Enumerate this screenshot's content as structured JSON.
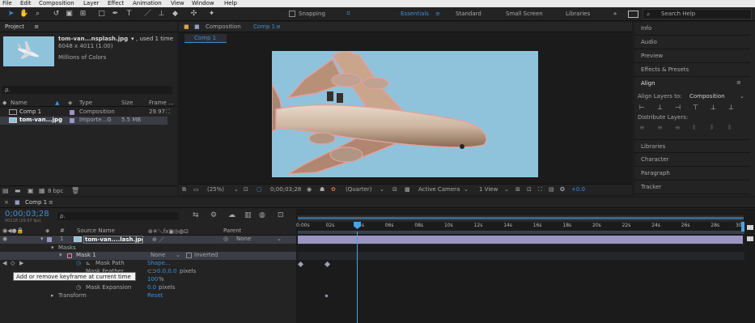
{
  "menu": [
    "File",
    "Edit",
    "Composition",
    "Layer",
    "Effect",
    "Animation",
    "View",
    "Window",
    "Help"
  ],
  "toolbar": {
    "snapping_label": "Snapping",
    "workspaces": [
      "Essentials",
      "Standard",
      "Small Screen",
      "Libraries"
    ],
    "overflow_glyph": "»",
    "search_placeholder": "Search Help"
  },
  "project": {
    "panel_title": "Project",
    "asset_name": "tom-van...nsplash.jpg",
    "asset_used": ", used 1 time",
    "asset_dims": "6048 x 4011 (1.00)",
    "asset_colors": "Millions of Colors",
    "search_icon_label": "ρ.",
    "columns": [
      "Name",
      "Type",
      "Size",
      "Frame ..."
    ],
    "items": [
      {
        "name": "Comp 1",
        "type": "Composition",
        "size": "",
        "frame": "29.97"
      },
      {
        "name": "tom-van...jpg",
        "type": "Importe...G",
        "size": "5.5 MB",
        "frame": ""
      }
    ],
    "bpc": "8 bpc"
  },
  "composition": {
    "panel_title": "Composition",
    "comp_name": "Comp 1",
    "tab_label": "Comp 1",
    "zoom": "(25%)",
    "timecode": "0;00;03;28",
    "resolution": "(Quarter)",
    "camera": "Active Camera",
    "views": "1 View",
    "exposure": "+0.0"
  },
  "right_panel": {
    "items_top": [
      "Info",
      "Audio",
      "Preview",
      "Effects & Presets"
    ],
    "align_title": "Align",
    "align_to_label": "Align Layers to:",
    "align_to_value": "Composition",
    "distribute_label": "Distribute Layers:",
    "items_bottom": [
      "Libraries",
      "Character",
      "Paragraph",
      "Tracker"
    ]
  },
  "timeline": {
    "tab": "Comp 1",
    "timecode": "0;00;03;28",
    "timecode_sub": "00118 (29.97 fps)",
    "search_icon_label": "ρ.",
    "col_source": "Source Name",
    "col_parent": "Parent",
    "layer_num": "1",
    "layer_name": "tom-van....lash.jpg",
    "parent_value": "None",
    "masks_label": "Masks",
    "mask_name": "Mask 1",
    "mask_mode": "None",
    "inverted_label": "Inverted",
    "mask_path": "Mask Path",
    "mask_path_value": "Shape...",
    "mask_feather": "Mask Feather",
    "mask_feather_value": "0.0,0.0",
    "mask_feather_unit": "pixels",
    "mask_opacity_value": "100",
    "mask_opacity_unit": "%",
    "mask_expansion": "Mask Expansion",
    "mask_expansion_value": "0.0",
    "mask_expansion_unit": "pixels",
    "transform": "Transform",
    "reset": "Reset",
    "tooltip": "Add or remove keyframe at current time",
    "ruler": [
      "0:00s",
      "02s",
      "04s",
      "06s",
      "08s",
      "10s",
      "12s",
      "14s",
      "16s",
      "18s",
      "20s",
      "22s",
      "24s",
      "26s",
      "28s",
      "30s"
    ]
  },
  "colors": {
    "accent_blue": "#3d8fd8",
    "sky": "#8fc3dc",
    "layer_bar": "#9a96c2",
    "work_area": "#49a3e6"
  }
}
